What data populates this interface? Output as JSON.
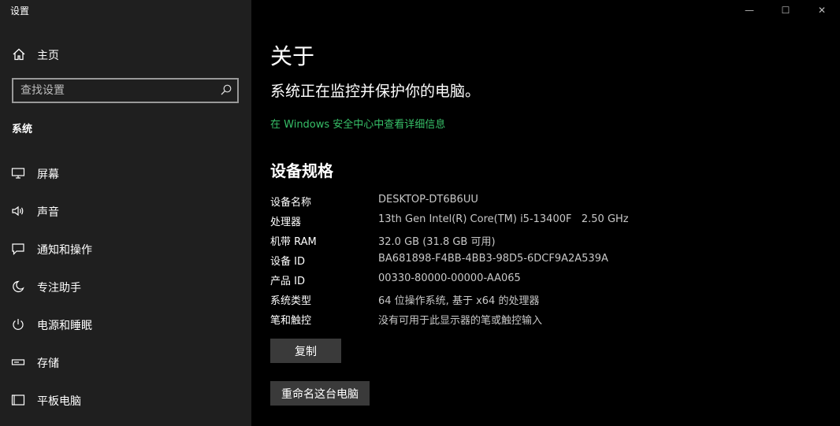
{
  "app": {
    "title": "设置"
  },
  "window_controls": {
    "minimize": "—",
    "maximize": "☐",
    "close": "✕"
  },
  "sidebar": {
    "home_label": "主页",
    "search_placeholder": "查找设置",
    "section_label": "系统",
    "items": [
      {
        "label": "屏幕",
        "icon": "monitor-icon"
      },
      {
        "label": "声音",
        "icon": "speaker-icon"
      },
      {
        "label": "通知和操作",
        "icon": "notification-icon"
      },
      {
        "label": "专注助手",
        "icon": "moon-icon"
      },
      {
        "label": "电源和睡眠",
        "icon": "power-icon"
      },
      {
        "label": "存储",
        "icon": "storage-icon"
      },
      {
        "label": "平板电脑",
        "icon": "tablet-icon"
      }
    ]
  },
  "main": {
    "title": "关于",
    "protection_text": "系统正在监控并保护你的电脑。",
    "security_link": "在 Windows 安全中心中查看详细信息",
    "specs_title": "设备规格",
    "specs": [
      {
        "key": "设备名称",
        "value": "DESKTOP-DT6B6UU"
      },
      {
        "key": "处理器",
        "value": "13th Gen Intel(R) Core(TM) i5-13400F   2.50 GHz"
      },
      {
        "key": "机带 RAM",
        "value": "32.0 GB (31.8 GB 可用)"
      },
      {
        "key": "设备 ID",
        "value": "BA681898-F4BB-4BB3-98D5-6DCF9A2A539A"
      },
      {
        "key": "产品 ID",
        "value": "00330-80000-00000-AA065"
      },
      {
        "key": "系统类型",
        "value": "64 位操作系统, 基于 x64 的处理器"
      },
      {
        "key": "笔和触控",
        "value": "没有可用于此显示器的笔或触控输入"
      }
    ],
    "copy_button": "复制",
    "rename_button": "重命名这台电脑"
  },
  "colors": {
    "link": "#37c068",
    "sidebar_bg": "#1f1f1f",
    "main_bg": "#000000"
  }
}
